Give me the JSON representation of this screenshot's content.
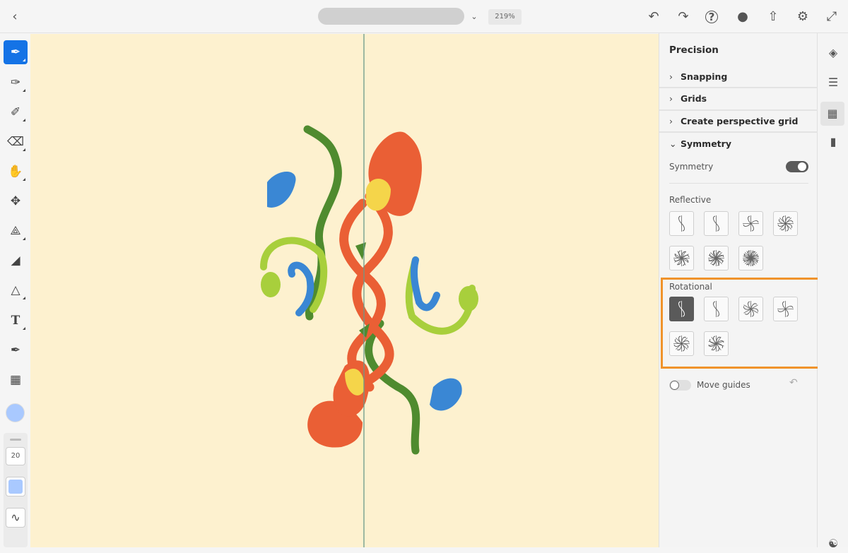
{
  "topbar": {
    "zoom_level": "219%",
    "icons": [
      "back-icon",
      "chevron-down-icon",
      "undo-icon",
      "redo-icon",
      "help-icon",
      "invite-icon",
      "share-icon",
      "settings-icon",
      "fullscreen-icon"
    ]
  },
  "toolbar": {
    "brush_size": "20",
    "color": "#a9c9ff",
    "tools": [
      "pixel-brush",
      "live-brush",
      "vector-brush",
      "eraser",
      "smudge",
      "transform",
      "lasso",
      "fill",
      "shape",
      "type",
      "eyedropper",
      "image"
    ]
  },
  "panel": {
    "title": "Precision",
    "sections": [
      "Snapping",
      "Grids",
      "Create perspective grid",
      "Symmetry"
    ],
    "symmetry_label": "Symmetry",
    "symmetry_on": true,
    "reflective_label": "Reflective",
    "rotational_label": "Rotational",
    "move_guides_label": "Move guides",
    "move_guides_on": false,
    "highlight_color": "#f0932b"
  },
  "canvas": {
    "background": "#fdf1cf"
  }
}
